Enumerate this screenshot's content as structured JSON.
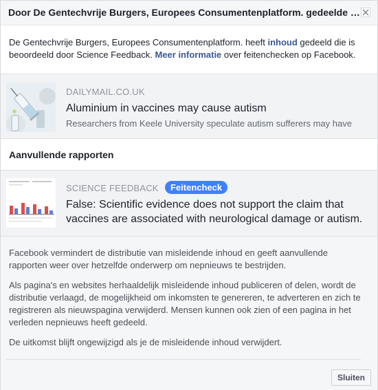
{
  "header": {
    "title": "Door De Gentechvrije Burgers, Europees Consumentenplatform. gedeelde inhoud"
  },
  "intro": {
    "part1": "De Gentechvrije Burgers, Europees Consumentenplatform. heeft ",
    "link1": "inhoud",
    "part2": " gedeeld die is beoordeeld door Science Feedback. ",
    "link2": "Meer informatie",
    "part3": " over feitenchecken op Facebook."
  },
  "shared_article": {
    "domain": "DAILYMAIL.CO.UK",
    "title": "Aluminium in vaccines may cause autism",
    "description": "Researchers from Keele University speculate autism sufferers may have"
  },
  "additional_reports": {
    "heading": "Aanvullende rapporten"
  },
  "fact_check": {
    "domain": "SCIENCE FEEDBACK",
    "badge": "Feitencheck",
    "title": "False: Scientific evidence does not support the claim that vaccines are associated with neurological damage or autism."
  },
  "info": {
    "p1": "Facebook vermindert de distributie van misleidende inhoud en geeft aanvullende rapporten weer over hetzelfde onderwerp om nepnieuws te bestrijden.",
    "p2": "Als pagina's en websites herhaaldelijk misleidende inhoud publiceren of delen, wordt de distributie verlaagd, de mogelijkheid om inkomsten te genereren, te adverteren en zich te registreren als nieuwspagina verwijderd. Mensen kunnen ook zien of een pagina in het verleden nepnieuws heeft gedeeld.",
    "p3": "De uitkomst blijft ongewijzigd als je de misleidende inhoud verwijdert."
  },
  "footer": {
    "close_label": "Sluiten"
  },
  "colors": {
    "link": "#385898",
    "badge": "#4080ff",
    "card_bg": "#f2f3f5"
  }
}
